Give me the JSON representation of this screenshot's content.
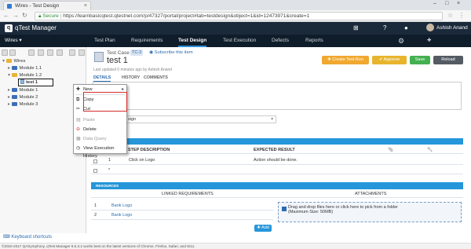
{
  "browser": {
    "tab_title": "Wires - Test Design",
    "secure_label": "Secure",
    "url": "https://learnbasicqtest.qtestnet.com/p/47327/portal/project#tab=testdesign&object=1&id=12473971&create=1"
  },
  "app": {
    "logo_letter": "q",
    "logo_text": "qTest Manager",
    "user_name": "Ashish Anand",
    "project_selector": "Wires ▾",
    "nav": [
      "Test Plan",
      "Requirements",
      "Test Design",
      "Test Execution",
      "Defects",
      "Reports"
    ],
    "active_nav": "Test Design"
  },
  "tree": {
    "root": "Wires",
    "items": [
      {
        "label": "Module 1.1"
      },
      {
        "label": "Module 1.2"
      },
      {
        "label": "test 1"
      },
      {
        "label": "Module 1"
      },
      {
        "label": "Module 2"
      },
      {
        "label": "Module 3"
      }
    ],
    "keyboard_shortcuts": "Keyboard shortcuts"
  },
  "testcase": {
    "type_label": "Test Case",
    "id_badge": "TC-3",
    "subscribe": "Subscribe this item",
    "title": "test 1",
    "updated": "Last updated 0 minutes ago by Ashish Anand",
    "tabs": [
      "DETAILS",
      "HISTORY",
      "COMMENTS"
    ],
    "buttons": {
      "create": "✚ Create Test Run",
      "approve": "✔ Approve",
      "save": "Save",
      "reload": "Reload"
    },
    "type_value": "sign",
    "steps": {
      "headers": [
        "STEP DESCRIPTION",
        "EXPECTED RESULT"
      ],
      "rows": [
        {
          "num": "1",
          "desc": "Click on Logo",
          "expected": "Action should be done."
        }
      ],
      "new_marker": "*"
    },
    "resources_label": "RESOURCES",
    "linked": {
      "header_linked": "LINKED REQUIREMENTS",
      "header_attachments": "ATTACHMENTS",
      "rows": [
        {
          "num": "1",
          "name": "Bank Logo"
        },
        {
          "num": "2",
          "name": "Bank Logo"
        }
      ],
      "drop_text": "Drag and drop files here or click here to pick from a folder",
      "max_size": "(Maximum Size: 50MB)",
      "add_label": "✚ Add"
    }
  },
  "context_menu": {
    "items": [
      {
        "label": "New",
        "icon": "plus-icon",
        "enabled": true
      },
      {
        "label": "Copy",
        "icon": "copy-icon",
        "enabled": true
      },
      {
        "label": "Cut",
        "icon": "cut-icon",
        "enabled": true
      },
      {
        "label": "Paste",
        "icon": "paste-icon",
        "enabled": false
      },
      {
        "label": "Delete",
        "icon": "delete-icon",
        "enabled": true
      },
      {
        "label": "Data Query",
        "icon": "query-icon",
        "enabled": false
      },
      {
        "label": "View Execution History",
        "icon": "history-icon",
        "enabled": true
      }
    ],
    "highlight_color": "#d42d2d"
  },
  "footer": {
    "text": "©2010-2017 QASymphony. qTest Manager 8.5.3.2 works best on the latest versions of Chrome, Firefox, Safari, and IE11."
  }
}
